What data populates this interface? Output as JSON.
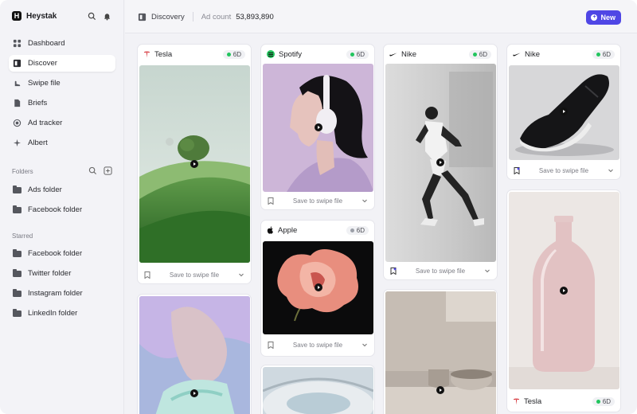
{
  "app": {
    "name": "Heystak"
  },
  "sidebar": {
    "nav": [
      {
        "label": "Dashboard",
        "icon": "grid-icon"
      },
      {
        "label": "Discover",
        "icon": "discover-icon",
        "active": true
      },
      {
        "label": "Swipe file",
        "icon": "swipe-icon"
      },
      {
        "label": "Briefs",
        "icon": "document-icon"
      },
      {
        "label": "Ad tracker",
        "icon": "target-icon"
      },
      {
        "label": "Albert",
        "icon": "sparkle-icon"
      }
    ],
    "folders_label": "Folders",
    "folders": [
      "Ads folder",
      "Facebook folder"
    ],
    "starred_label": "Starred",
    "starred": [
      "Facebook folder",
      "Twitter folder",
      "Instagram folder",
      "LinkedIn folder"
    ]
  },
  "header": {
    "title": "Discovery",
    "ad_count_label": "Ad count",
    "ad_count": "53,893,890",
    "new_button": "New"
  },
  "colors": {
    "accent": "#4f46e5",
    "status_active": "#22c55e",
    "status_inactive": "#9ca0a8"
  },
  "cards": [
    {
      "brand": "Tesla",
      "badge": "6D",
      "active": true,
      "save_label": "Save to swipe file",
      "media": "green-hills"
    },
    {
      "brand": "Spotify",
      "badge": "6D",
      "active": true,
      "save_label": "Save to swipe file",
      "media": "headphones-portrait"
    },
    {
      "brand": "Nike",
      "badge": "6D",
      "active": true,
      "save_label": "Save to swipe file",
      "media": "runner"
    },
    {
      "brand": "Nike",
      "badge": "6D",
      "active": true,
      "save_label": "Save to swipe file",
      "media": "sneaker"
    },
    {
      "brand": "Apple",
      "badge": "6D",
      "active": false,
      "save_label": "Save to swipe file",
      "media": "flower"
    },
    {
      "brand": "Tesla",
      "badge": "6D",
      "active": true,
      "media": "glass-bottle"
    }
  ]
}
